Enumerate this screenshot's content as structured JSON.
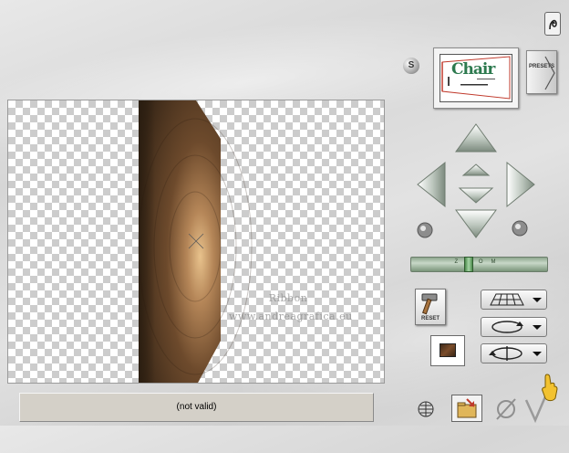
{
  "status": {
    "text": "(not valid)"
  },
  "preview": {
    "watermark_line1": "Ribbon",
    "watermark_line2": "www.andreagrafica.eu"
  },
  "thumbnail": {
    "title": "Chair"
  },
  "presets": {
    "label": "PRESETS"
  },
  "s_button": {
    "label": "S"
  },
  "zoom": {
    "label": "ZOOM",
    "level": 0.42
  },
  "reset": {
    "label": "RESET"
  },
  "colors": {
    "wall_dark": "#3a2a18",
    "wall_light": "#d8b27f",
    "checker": "#cccccc",
    "status_bg": "#d4d0c8",
    "arrow_gray": "#bcc6bd"
  },
  "icons": {
    "help": "help-icon",
    "s": "s-circle-icon",
    "presets": "presets-arrow-icon",
    "arrow_up": "arrow-up-icon",
    "arrow_down": "arrow-down-icon",
    "arrow_left": "arrow-left-icon",
    "arrow_right": "arrow-right-icon",
    "rotate_left": "rotate-left-icon",
    "rotate_right": "rotate-right-icon",
    "grid": "grid-mode-icon",
    "rotate": "rotate-mode-icon",
    "flip": "flip-mode-icon",
    "reset": "hammer-icon",
    "texture": "texture-icon",
    "globe": "globe-icon",
    "folder": "folder-export-icon",
    "cancel": "cancel-icon",
    "ok": "check-icon",
    "hand": "pointing-hand-icon"
  }
}
